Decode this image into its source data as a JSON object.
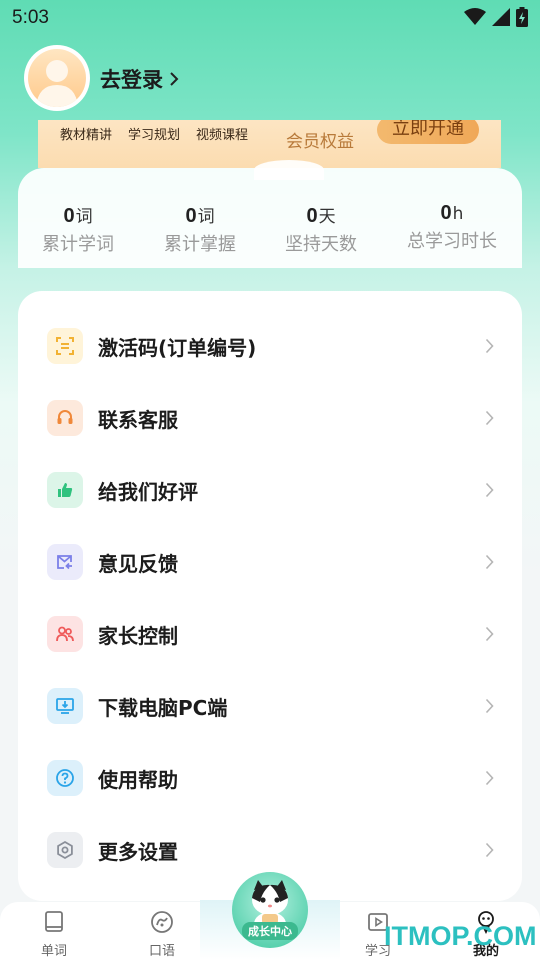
{
  "status_bar": {
    "time": "5:03"
  },
  "profile": {
    "login_label": "去登录"
  },
  "vip": {
    "features": [
      "教材精讲",
      "学习规划",
      "视频课程"
    ],
    "rights_label": "会员权益",
    "open_button": "立即开通"
  },
  "stats": [
    {
      "value": "0",
      "unit": "词",
      "label": "累计学词"
    },
    {
      "value": "0",
      "unit": "词",
      "label": "累计掌握"
    },
    {
      "value": "0",
      "unit": "天",
      "label": "坚持天数"
    },
    {
      "value": "0",
      "unit": "h",
      "label": "总学习时长"
    }
  ],
  "menu": {
    "items": [
      {
        "label": "激活码(订单编号)",
        "icon": "scan-code-icon",
        "color": "#f2b233"
      },
      {
        "label": "联系客服",
        "icon": "headset-icon",
        "color": "#f0883a"
      },
      {
        "label": "给我们好评",
        "icon": "thumbs-up-icon",
        "color": "#2fc27e"
      },
      {
        "label": "意见反馈",
        "icon": "mail-feedback-icon",
        "color": "#7b7fe8"
      },
      {
        "label": "家长控制",
        "icon": "parents-icon",
        "color": "#ef5a5a"
      },
      {
        "label": "下载电脑PC端",
        "icon": "monitor-download-icon",
        "color": "#2aa4e8"
      },
      {
        "label": "使用帮助",
        "icon": "help-icon",
        "color": "#2aa4e8"
      },
      {
        "label": "更多设置",
        "icon": "gear-icon",
        "color": "#8a8f99"
      }
    ]
  },
  "tabbar": {
    "tabs": [
      {
        "label": "单词",
        "icon": "book-icon"
      },
      {
        "label": "口语",
        "icon": "speaking-icon"
      },
      {
        "label": "学习",
        "icon": "video-play-icon"
      },
      {
        "label": "我的",
        "icon": "profile-mascot-icon",
        "active": true
      }
    ],
    "center_label": "成长中心"
  },
  "watermark": "ITMOP.COM",
  "colors": {
    "accent": "#5fdcb4",
    "vip_gold": "#f0a858"
  }
}
